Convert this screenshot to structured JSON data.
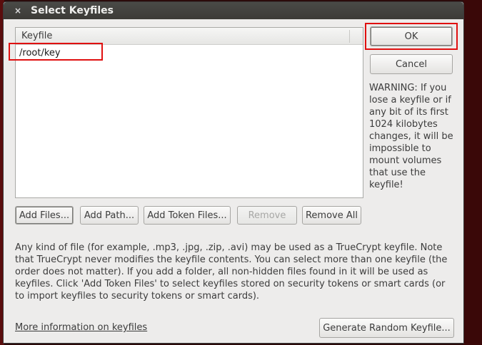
{
  "window": {
    "title": "Select Keyfiles",
    "close_glyph": "×"
  },
  "list": {
    "column_header": "Keyfile",
    "rows": [
      "/root/key"
    ]
  },
  "buttons": {
    "ok": "OK",
    "cancel": "Cancel",
    "add_files": "Add Files...",
    "add_path": "Add Path...",
    "add_token_files": "Add Token Files...",
    "remove": "Remove",
    "remove_all": "Remove All",
    "generate_random": "Generate Random Keyfile..."
  },
  "warning_text": "WARNING: If you lose a keyfile or if any bit of its first 1024 kilobytes changes, it will be impossible to mount volumes that use the keyfile!",
  "info_text": "Any kind of file (for example, .mp3, .jpg, .zip, .avi) may be used as a TrueCrypt keyfile. Note that TrueCrypt never modifies the keyfile contents. You can select more than one keyfile (the order does not matter). If you add a folder, all non-hidden files found in it will be used as keyfiles. Click 'Add Token Files' to select keyfiles stored on security tokens or smart cards (or to import keyfiles to security tokens or smart cards).",
  "more_info_link": "More information on keyfiles",
  "colors": {
    "highlight": "#e01010",
    "dialog_bg": "#edeceb",
    "titlebar": "#3c3b37"
  }
}
